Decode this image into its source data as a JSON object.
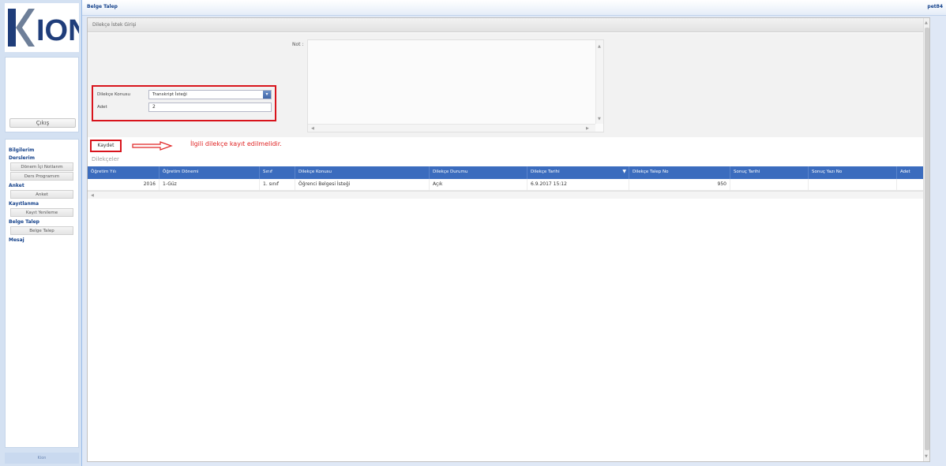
{
  "app": {
    "logo_text": "ION",
    "logout_label": "Çıkış",
    "footer_text": "Kion"
  },
  "sidebar": {
    "groups": [
      {
        "label": "Bilgilerim",
        "items": []
      },
      {
        "label": "Derslerim",
        "items": [
          "Dönem İçi Notlarım",
          "Ders Programım"
        ]
      },
      {
        "label": "Anket",
        "items": [
          "Anket"
        ]
      },
      {
        "label": "Kayıtlanma",
        "items": [
          "Kayıt Yenileme"
        ]
      },
      {
        "label": "Belge Talep",
        "items": [
          "Belge Talep"
        ]
      },
      {
        "label": "Mesaj",
        "items": []
      }
    ]
  },
  "topbar": {
    "title": "Belge Talep",
    "user": "pet84"
  },
  "form": {
    "header": "Dilekçe İstek Girişi",
    "net_label": "Not :",
    "konu_label": "Dilekçe Konusu",
    "konu_value": "Transkript İsteği",
    "adet_label": "Adet",
    "adet_value": "2"
  },
  "actions": {
    "save_label": "Kaydet",
    "note": "İlgili dilekçe kayıt edilmelidir."
  },
  "grid": {
    "title": "Dilekçeler",
    "columns": [
      "Öğretim Yılı",
      "Öğretim Dönemi",
      "Sınıf",
      "Dilekçe Konusu",
      "Dilekçe Durumu",
      "Dilekçe Tarihi",
      "Dilekçe Talep No",
      "Sonuç Tarihi",
      "Sonuç Yazı No",
      "Adet"
    ],
    "sorted_column": "Dilekçe Tarihi",
    "rows": [
      [
        "2016",
        "1-Güz",
        "1. sınıf",
        "Öğrenci Belgesi İsteği",
        "Açık",
        "6.9.2017 15:12",
        "950",
        "",
        "",
        ""
      ]
    ]
  },
  "colors": {
    "accent": "#3b6cbe",
    "highlight_red": "#d8141c",
    "sidebar_bg": "#d4e1f2"
  }
}
